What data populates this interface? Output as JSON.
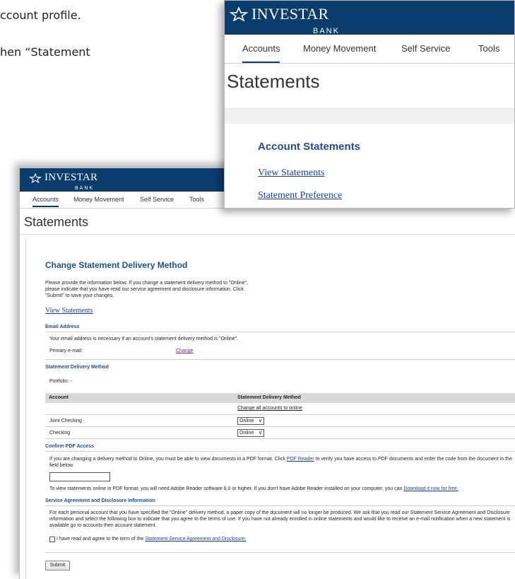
{
  "document": {
    "line1": "ccount profile.",
    "line2": "hen “Statement"
  },
  "brand": {
    "name": "INVESTAR",
    "sub": "BANK",
    "header_color": "#0a3d6e",
    "heading_color": "#1e4f8f"
  },
  "popup": {
    "nav": [
      "Accounts",
      "Money Movement",
      "Self Service",
      "Tools"
    ],
    "page_title": "Statements",
    "section_title": "Account Statements",
    "links": [
      "View Statements",
      "Statement Preference"
    ]
  },
  "main": {
    "nav": [
      "Accounts",
      "Money Movement",
      "Self Service",
      "Tools"
    ],
    "page_title": "Statements",
    "form_title": "Change Statement Delivery Method",
    "intro": "Please provide the information below. If you change a statement delivery method to \"Online\", please indicate that you have read our service agreement and disclosure information. Click \"Submit\" to save your changes.",
    "view_statements_link": "View Statements",
    "email": {
      "title": "Email Address",
      "note": "Your email address is necessary if an account's statement delivery method is \"Online\".",
      "label": "Primary e-mail:",
      "change_link": "Change"
    },
    "delivery": {
      "title": "Statement Delivery Method",
      "portfolio": "Portfolio: -",
      "col_account": "Account",
      "col_method": "Statement Delivery Method",
      "change_all_link": "Change all accounts to online",
      "rows": [
        {
          "account": "Joint Checking",
          "method": "Online"
        },
        {
          "account": "Checking",
          "method": "Online"
        }
      ]
    },
    "pdf": {
      "title": "Confirm PDF Access",
      "text_before_link": "If you are changing a delivery method to Online, you must be able to view documents in a PDF format. Click ",
      "reader_link": "PDF Reader",
      "text_after_link": " to verify you have access to PDF documents and enter the code from the document in the field below.",
      "code_value": "",
      "adobe_text": "To view statements online in PDF format, you will need Adobe Reader software 6.0 or higher. If you don't have Adobe Reader installed on your computer, you can ",
      "download_link": "Download it now for free."
    },
    "agreement": {
      "title": "Service Agreement and Disclosure Information",
      "text": "For each personal account that you have specified the \"Online\" delivery method, a paper copy of the document will no longer be produced. We ask that you read our Statement Service Agreement and Disclosure information and select the following box to indicate that you agree to the terms of use. If you have not already enrolled in online statements and would like to receive an e-mail notification when a new statement is available go to accounts then account statement.",
      "checkbox_label": "I have read and agree to the term of the ",
      "checkbox_link": "Statement Service Agreement and Disclosure."
    },
    "submit_label": "Submit"
  }
}
